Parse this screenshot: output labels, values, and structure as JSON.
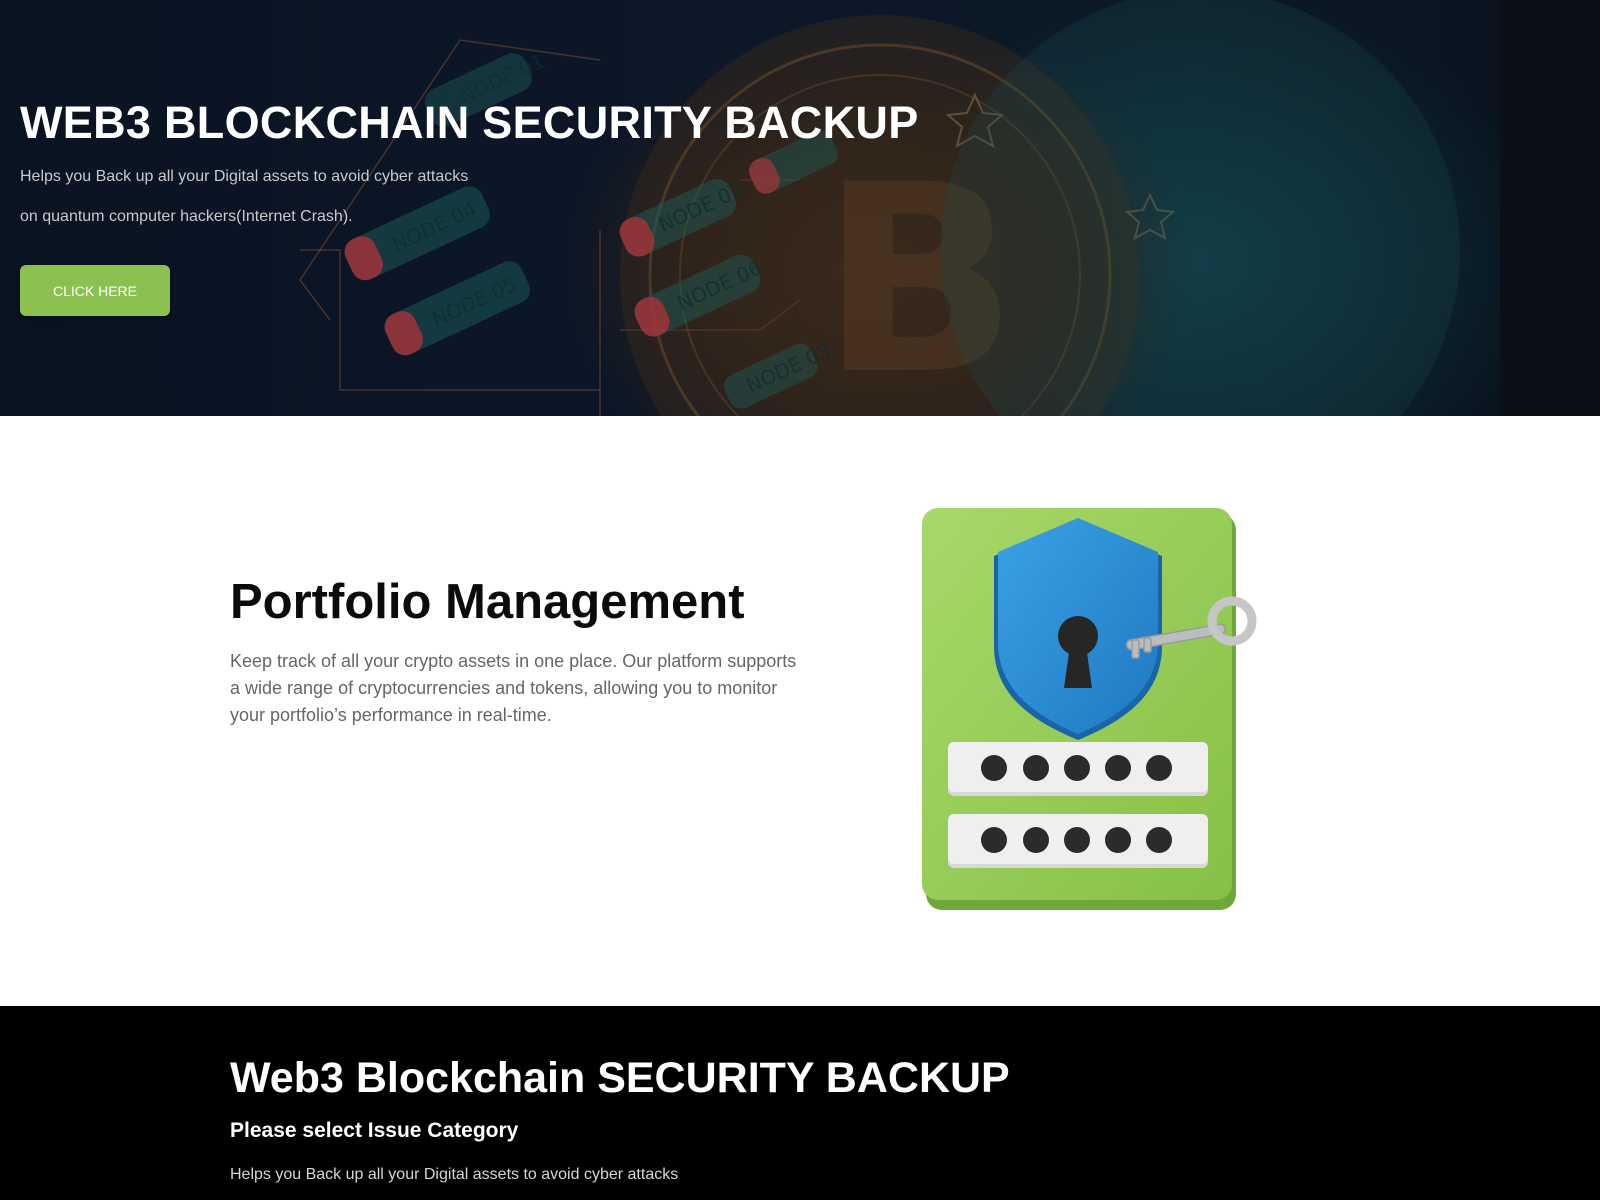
{
  "hero": {
    "title": "WEB3 BLOCKCHAIN SECURITY BACKUP",
    "subtitle_line1": "Helps you Back up all your Digital assets to avoid cyber attacks",
    "subtitle_line2": "on quantum computer hackers(Internet Crash).",
    "button_label": "CLICK HERE",
    "node_labels": [
      "NODE 01",
      "NODE 02",
      "NODE 04",
      "NODE 05",
      "NODE 06",
      "NODE 03"
    ],
    "background_image": "blockchain-bitcoin-nodes-image",
    "button_color": "#8cc152"
  },
  "portfolio": {
    "title": "Portfolio Management",
    "description": "Keep track of all your crypto assets in one place. Our platform supports a wide range of cryptocurrencies and tokens, allowing you to monitor your portfolio’s performance in real-time.",
    "illustration": "security-shield-lock-key-password-icon",
    "accent_green": "#9ccf5a",
    "shield_blue": "#2a8fd6"
  },
  "footer": {
    "title": "Web3 Blockchain SECURITY BACKUP",
    "subtitle": "Please select Issue Category",
    "text": "Helps you Back up all your Digital assets to avoid cyber attacks"
  }
}
